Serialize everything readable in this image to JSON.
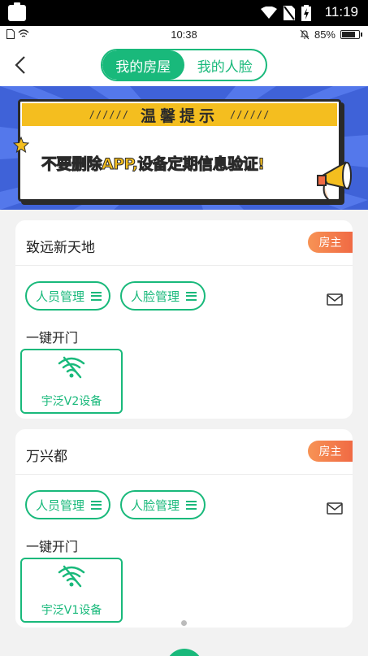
{
  "system_bar": {
    "time": "11:19"
  },
  "device_bar": {
    "time": "10:38",
    "battery": "85%",
    "battery_level": 0.85
  },
  "header": {
    "tabs": [
      {
        "label": "我的房屋",
        "active": true
      },
      {
        "label": "我的人脸",
        "active": false
      }
    ]
  },
  "banner": {
    "title": "温馨提示",
    "slashes": "//////",
    "message": "不要删除APP,设备定期信息验证!"
  },
  "houses": [
    {
      "name": "致远新天地",
      "role": "房主",
      "actions": [
        "人员管理",
        "人脸管理"
      ],
      "open_label": "一键开门",
      "device": "宇泛V2设备"
    },
    {
      "name": "万兴都",
      "role": "房主",
      "actions": [
        "人员管理",
        "人脸管理"
      ],
      "open_label": "一键开门",
      "device": "宇泛V1设备"
    }
  ],
  "colors": {
    "accent": "#19b97b",
    "badge": "#f06a44",
    "banner_bg": "#3f62d8",
    "notice_yellow": "#f4be1f"
  },
  "icons": [
    "back-arrow-icon",
    "menu-lines-icon",
    "mail-icon",
    "wifi-off-icon",
    "star-icon",
    "megaphone-icon"
  ]
}
